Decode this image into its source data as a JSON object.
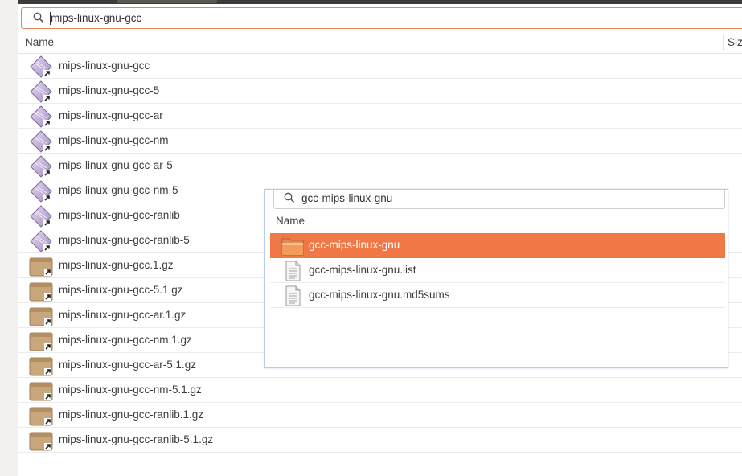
{
  "search": {
    "value": "mips-linux-gnu-gcc"
  },
  "columns": {
    "name": "Name",
    "size": "Siz"
  },
  "files": [
    {
      "name": "mips-linux-gnu-gcc",
      "icon": "executable-link-icon"
    },
    {
      "name": "mips-linux-gnu-gcc-5",
      "icon": "executable-link-icon"
    },
    {
      "name": "mips-linux-gnu-gcc-ar",
      "icon": "executable-link-icon"
    },
    {
      "name": "mips-linux-gnu-gcc-nm",
      "icon": "executable-link-icon"
    },
    {
      "name": "mips-linux-gnu-gcc-ar-5",
      "icon": "executable-link-icon"
    },
    {
      "name": "mips-linux-gnu-gcc-nm-5",
      "icon": "executable-link-icon"
    },
    {
      "name": "mips-linux-gnu-gcc-ranlib",
      "icon": "executable-link-icon"
    },
    {
      "name": "mips-linux-gnu-gcc-ranlib-5",
      "icon": "executable-link-icon"
    },
    {
      "name": "mips-linux-gnu-gcc.1.gz",
      "icon": "archive-link-icon"
    },
    {
      "name": "mips-linux-gnu-gcc-5.1.gz",
      "icon": "archive-link-icon"
    },
    {
      "name": "mips-linux-gnu-gcc-ar.1.gz",
      "icon": "archive-link-icon"
    },
    {
      "name": "mips-linux-gnu-gcc-nm.1.gz",
      "icon": "archive-link-icon"
    },
    {
      "name": "mips-linux-gnu-gcc-ar-5.1.gz",
      "icon": "archive-link-icon"
    },
    {
      "name": "mips-linux-gnu-gcc-nm-5.1.gz",
      "icon": "archive-link-icon"
    },
    {
      "name": "mips-linux-gnu-gcc-ranlib.1.gz",
      "icon": "archive-link-icon"
    },
    {
      "name": "mips-linux-gnu-gcc-ranlib-5.1.gz",
      "icon": "archive-link-icon"
    }
  ],
  "popup": {
    "search_value": "gcc-mips-linux-gnu",
    "column_name": "Name",
    "items": [
      {
        "name": "gcc-mips-linux-gnu",
        "icon": "folder-icon",
        "selected": true
      },
      {
        "name": "gcc-mips-linux-gnu.list",
        "icon": "text-file-icon"
      },
      {
        "name": "gcc-mips-linux-gnu.md5sums",
        "icon": "text-file-icon"
      }
    ]
  },
  "colors": {
    "accent": "#f07746",
    "focus_border": "#e4875a"
  }
}
